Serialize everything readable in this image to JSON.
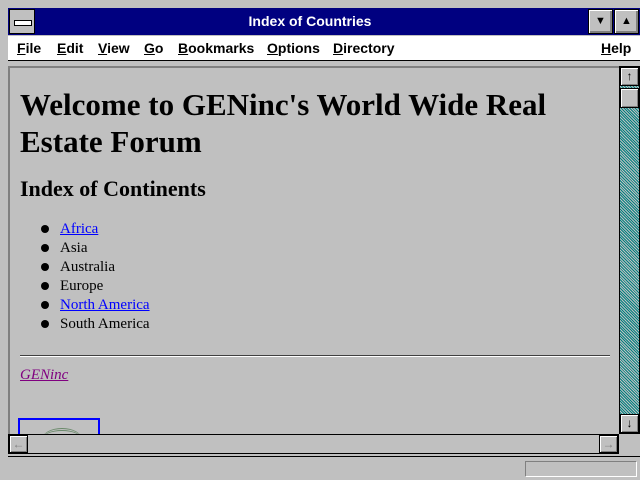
{
  "window": {
    "title": "Index of Countries"
  },
  "titlebar": {
    "minimize_icon": "▼",
    "maximize_icon": "▲"
  },
  "menu": {
    "items": [
      {
        "first": "F",
        "rest": "ile"
      },
      {
        "first": "E",
        "rest": "dit"
      },
      {
        "first": "V",
        "rest": "iew"
      },
      {
        "first": "G",
        "rest": "o"
      },
      {
        "first": "B",
        "rest": "ookmarks"
      },
      {
        "first": "O",
        "rest": "ptions"
      },
      {
        "first": "D",
        "rest": "irectory"
      },
      {
        "first": "H",
        "rest": "elp"
      }
    ]
  },
  "page": {
    "heading": "Welcome to GENinc's World Wide Real Estate Forum",
    "subheading": "Index of Continents",
    "continents": [
      {
        "label": "Africa",
        "link": true
      },
      {
        "label": "Asia",
        "link": false
      },
      {
        "label": "Australia",
        "link": false
      },
      {
        "label": "Europe",
        "link": false
      },
      {
        "label": "North America",
        "link": true
      },
      {
        "label": "South America",
        "link": false
      }
    ],
    "footer_link": "GENinc"
  },
  "scrollbar": {
    "up_icon": "↑",
    "down_icon": "↓",
    "left_icon": "←",
    "right_icon": "→"
  },
  "statusbar": {
    "text": ""
  },
  "colors": {
    "titlebar": "#000080",
    "link": "#0000ff",
    "visited_link": "#800080",
    "background": "#c0c0c0"
  }
}
